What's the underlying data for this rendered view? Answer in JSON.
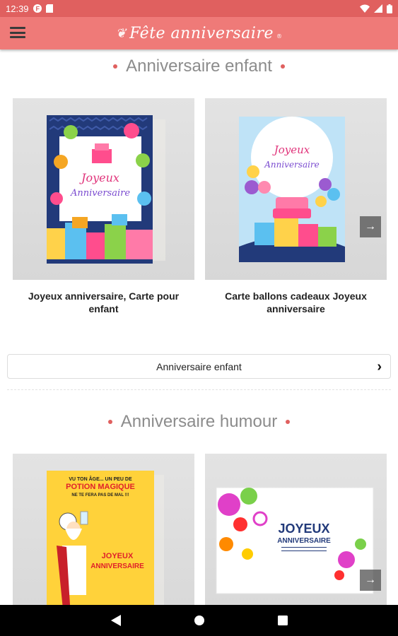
{
  "status": {
    "time": "12:39"
  },
  "appbar": {
    "logo_text": "Fête anniversaire",
    "trademark": "®"
  },
  "sections": [
    {
      "title": "Anniversaire enfant",
      "cards": [
        {
          "caption": "Joyeux anniversaire, Carte pour enfant",
          "card_text": "Joyeux Anniversaire"
        },
        {
          "caption": "Carte ballons cadeaux Joyeux anniversaire",
          "card_text": "Joyeux Anniversaire"
        }
      ],
      "see_more_label": "Anniversaire enfant"
    },
    {
      "title": "Anniversaire humour",
      "cards": [
        {
          "caption": "",
          "card_text_top": "VU TON ÂGE... UN PEU DE",
          "card_text_mid": "POTION MAGIQUE",
          "card_text_sub": "NE TE FERA PAS DE MAL !!!",
          "card_text_bottom": "JOYEUX ANNIVERSAIRE"
        },
        {
          "caption": "",
          "card_text_title": "JOYEUX",
          "card_text_sub": "ANNIVERSAIRE"
        }
      ]
    }
  ],
  "colors": {
    "accent": "#ef7a78",
    "status": "#e0605f",
    "title_text": "#8c8c8c"
  },
  "icons": [
    "menu-icon",
    "next-arrow-icon",
    "chevron-right-icon",
    "back-icon",
    "home-icon",
    "recents-icon"
  ]
}
